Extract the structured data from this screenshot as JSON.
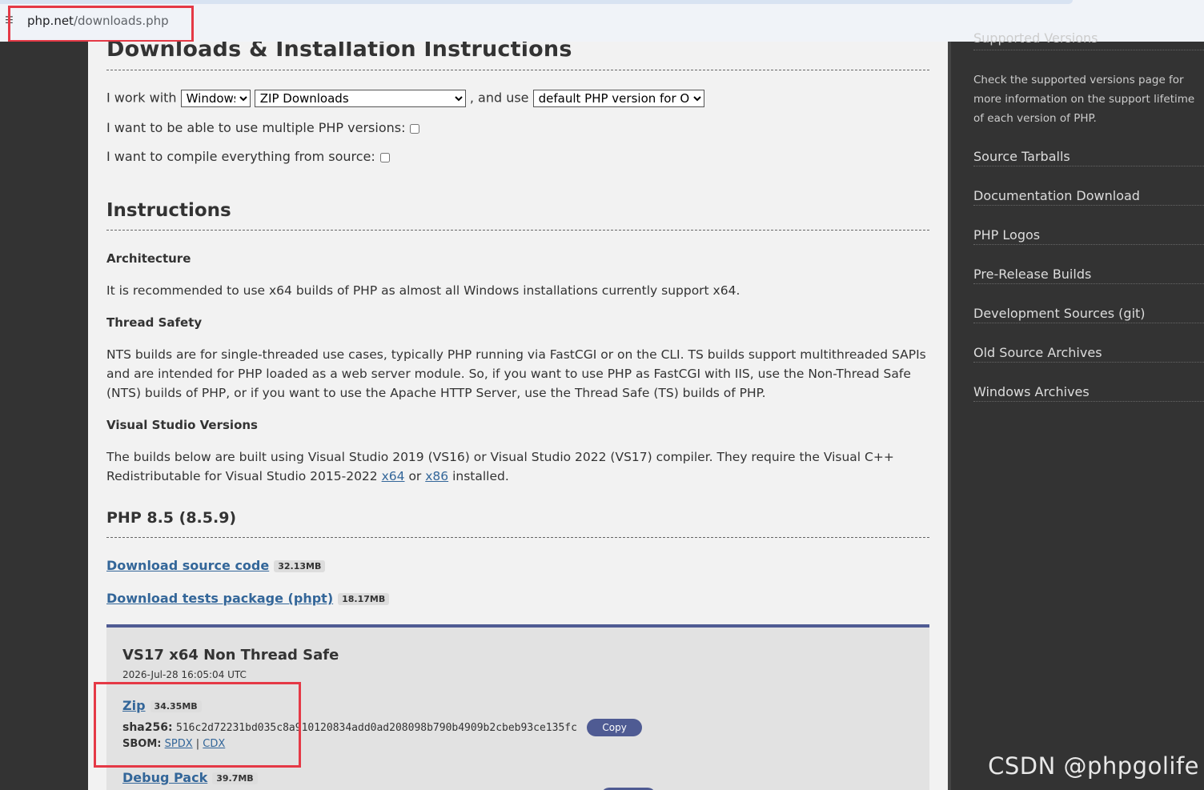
{
  "browser": {
    "url_host": "php.net",
    "url_path": "/downloads.php"
  },
  "main": {
    "heading": "Downloads & Installation Instructions",
    "work_with_label": "I work with",
    "os_select": "Windows",
    "type_select": "ZIP Downloads",
    "and_use_label": ", and use",
    "version_select": "default PHP version for OS",
    "multiple_label": "I want to be able to use multiple PHP versions:",
    "compile_label": "I want to compile everything from source:",
    "instructions_heading": "Instructions",
    "arch_heading": "Architecture",
    "arch_text": "It is recommended to use x64 builds of PHP as almost all Windows installations currently support x64.",
    "ts_heading": "Thread Safety",
    "ts_text": "NTS builds are for single-threaded use cases, typically PHP running via FastCGI or on the CLI. TS builds support multithreaded SAPIs and are intended for PHP loaded as a web server module. So, if you want to use PHP as FastCGI with IIS, use the Non-Thread Safe (NTS) builds of PHP, or if you want to use the Apache HTTP Server, use the Thread Safe (TS) builds of PHP.",
    "vs_heading": "Visual Studio Versions",
    "vs_text_1": "The builds below are built using Visual Studio 2019 (VS16) or Visual Studio 2022 (VS17) compiler. They require the Visual C++ Redistributable for Visual Studio 2015-2022",
    "vs_link_x64": "x64",
    "vs_or": "or",
    "vs_link_x86": "x86",
    "vs_text_2": "installed.",
    "php_version_heading": "PHP 8.5 (8.5.9)",
    "download_source": "Download source code",
    "download_source_size": "32.13MB",
    "download_tests": "Download tests package (phpt)",
    "download_tests_size": "18.17MB"
  },
  "build": {
    "title": "VS17 x64 Non Thread Safe",
    "date": "2026-Jul-28 16:05:04 UTC",
    "zip_label": "Zip",
    "zip_size": "34.35MB",
    "sha_label": "sha256:",
    "sha_value": "516c2d72231bd035c8a910120834add0ad208098b790b4909b2cbeb93ce135fc",
    "copy_label": "Copy",
    "sbom_label": "SBOM:",
    "sbom_spdx": "SPDX",
    "sbom_sep": "|",
    "sbom_cdx": "CDX",
    "debug_label": "Debug Pack",
    "debug_size": "39.7MB"
  },
  "sidebar": {
    "partial_heading": "Supported Versions",
    "description": "Check the supported versions page for more information on the support lifetime of each version of PHP.",
    "links": [
      "Source Tarballs",
      "Documentation Download",
      "PHP Logos",
      "Pre-Release Builds",
      "Development Sources (git)",
      "Old Source Archives",
      "Windows Archives"
    ]
  },
  "watermark": "CSDN @phpgolife",
  "colors": {
    "accent": "#4f5b93",
    "link": "#336699",
    "highlight_box": "#e53946"
  }
}
